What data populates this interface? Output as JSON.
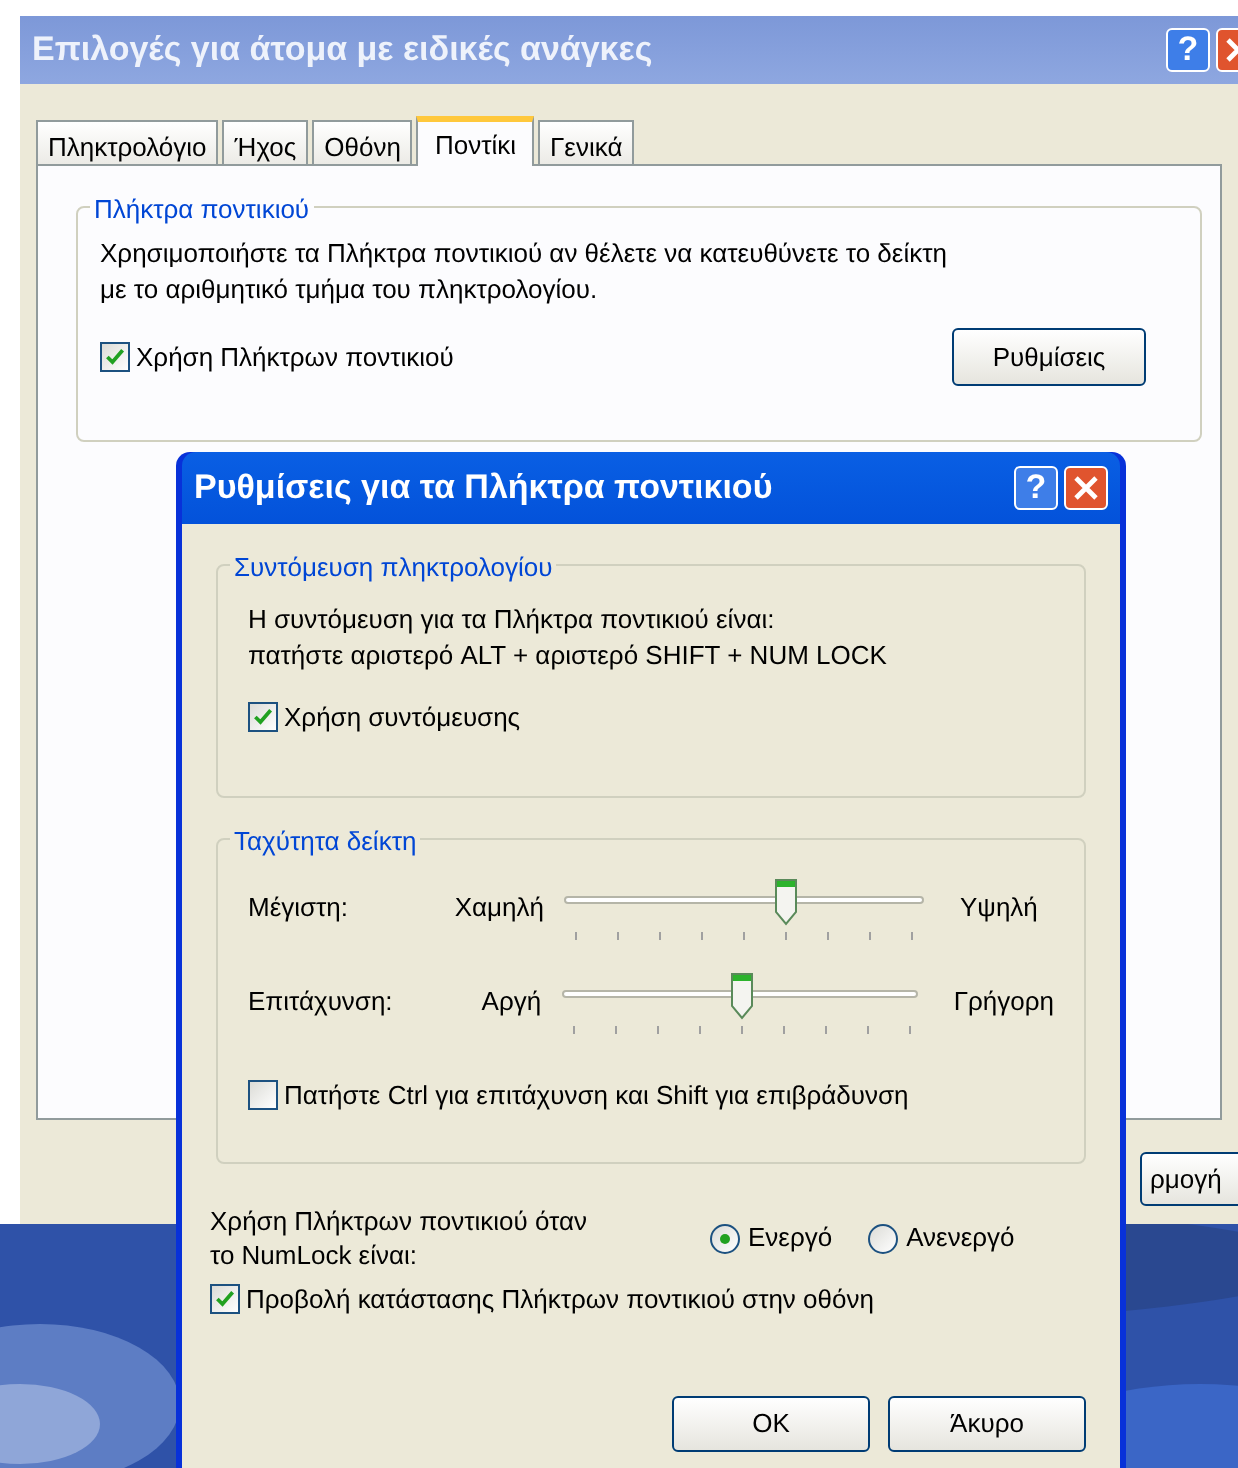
{
  "main_window": {
    "title": "Επιλογές για άτομα με ειδικές ανάγκες",
    "help_button": "?",
    "tabs": [
      {
        "label": "Πληκτρολόγιο",
        "selected": false
      },
      {
        "label": "Ήχος",
        "selected": false
      },
      {
        "label": "Οθόνη",
        "selected": false
      },
      {
        "label": "Ποντίκι",
        "selected": true
      },
      {
        "label": "Γενικά",
        "selected": false
      }
    ],
    "group": {
      "title": "Πλήκτρα ποντικιού",
      "description_lines": [
        "Χρησιμοποιήστε τα Πλήκτρα ποντικιού αν θέλετε να κατευθύνετε το δείκτη",
        "με το αριθμητικό τμήμα του πληκτρολογίου."
      ],
      "checkbox": {
        "label": "Χρήση Πλήκτρων ποντικιού",
        "checked": true
      },
      "settings_button": "Ρυθμίσεις"
    },
    "partial_button": "ρμογή"
  },
  "dialog": {
    "title": "Ρυθμίσεις για τα Πλήκτρα ποντικιού",
    "help_button": "?",
    "shortcut_group": {
      "title": "Συντόμευση πληκτρολογίου",
      "description_lines": [
        "Η συντόμευση για τα Πλήκτρα ποντικιού είναι:",
        "πατήστε αριστερό ALT + αριστερό SHIFT + NUM LOCK"
      ],
      "checkbox": {
        "label": "Χρήση συντόμευσης",
        "checked": true
      }
    },
    "speed_group": {
      "title": "Ταχύτητα δείκτη",
      "sliders": [
        {
          "label": "Μέγιστη:",
          "min_label": "Χαμηλή",
          "max_label": "Υψηλή",
          "level": 0.625
        },
        {
          "label": "Επιτάχυνση:",
          "min_label": "Αργή",
          "max_label": "Γρήγορη",
          "level": 0.5
        }
      ],
      "checkbox": {
        "label": "Πατήστε Ctrl για επιτάχυνση και Shift για επιβράδυνση",
        "checked": false
      }
    },
    "numlock": {
      "label_lines": [
        "Χρήση Πλήκτρων ποντικιού όταν",
        "το NumLock είναι:"
      ],
      "options": [
        {
          "label": "Ενεργό",
          "selected": true
        },
        {
          "label": "Ανενεργό",
          "selected": false
        }
      ]
    },
    "status_checkbox": {
      "label": "Προβολή κατάστασης Πλήκτρων ποντικιού στην οθόνη",
      "checked": true
    },
    "buttons": [
      "OK",
      "Άκυρο"
    ]
  }
}
